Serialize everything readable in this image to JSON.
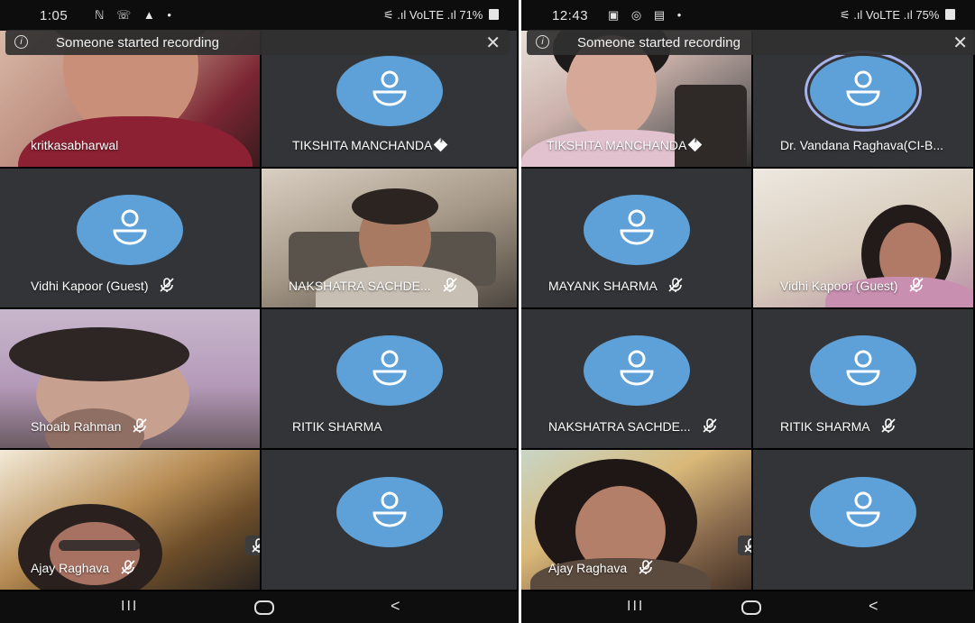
{
  "left": {
    "status": {
      "time": "1:05",
      "icons": "ℕ ☏ ▲ •",
      "right": "⚟ .ıl VoLTE .ıl",
      "battery": "71%"
    },
    "banner": {
      "text": "Someone started recording"
    },
    "participants": [
      {
        "name": "kritkasabharwal"
      },
      {
        "name": "TIKSHITA MANCHANDA"
      },
      {
        "name": "Vidhi Kapoor (Guest)"
      },
      {
        "name": "NAKSHATRA SACHDE..."
      },
      {
        "name": "Shoaib Rahman"
      },
      {
        "name": "RITIK SHARMA"
      },
      {
        "name": "Ajay Raghava"
      },
      {
        "name": ""
      }
    ],
    "nav": {
      "recent": "III",
      "home": "",
      "back": "<"
    }
  },
  "right": {
    "status": {
      "time": "12:43",
      "icons": "▣ ◎ ▤ •",
      "right": "⚟ .ıl VoLTE .ıl",
      "battery": "75%"
    },
    "banner": {
      "text": "Someone started recording"
    },
    "participants": [
      {
        "name": "TIKSHITA MANCHANDA"
      },
      {
        "name": "Dr. Vandana Raghava(CI-B..."
      },
      {
        "name": "MAYANK SHARMA"
      },
      {
        "name": "Vidhi Kapoor (Guest)"
      },
      {
        "name": "NAKSHATRA SACHDE..."
      },
      {
        "name": "RITIK SHARMA"
      },
      {
        "name": "Ajay Raghava"
      },
      {
        "name": ""
      }
    ],
    "nav": {
      "recent": "III",
      "home": "",
      "back": "<"
    }
  },
  "colors": {
    "tile_dark": "#333437",
    "avatar_blue": "#5ea1d8",
    "speaking_ring": "#a7b3ea"
  },
  "icons": {
    "avatar": "person-icon",
    "muted": "mic-off-icon",
    "pinned": "pin-icon",
    "info": "info-icon",
    "close": "close-icon"
  }
}
